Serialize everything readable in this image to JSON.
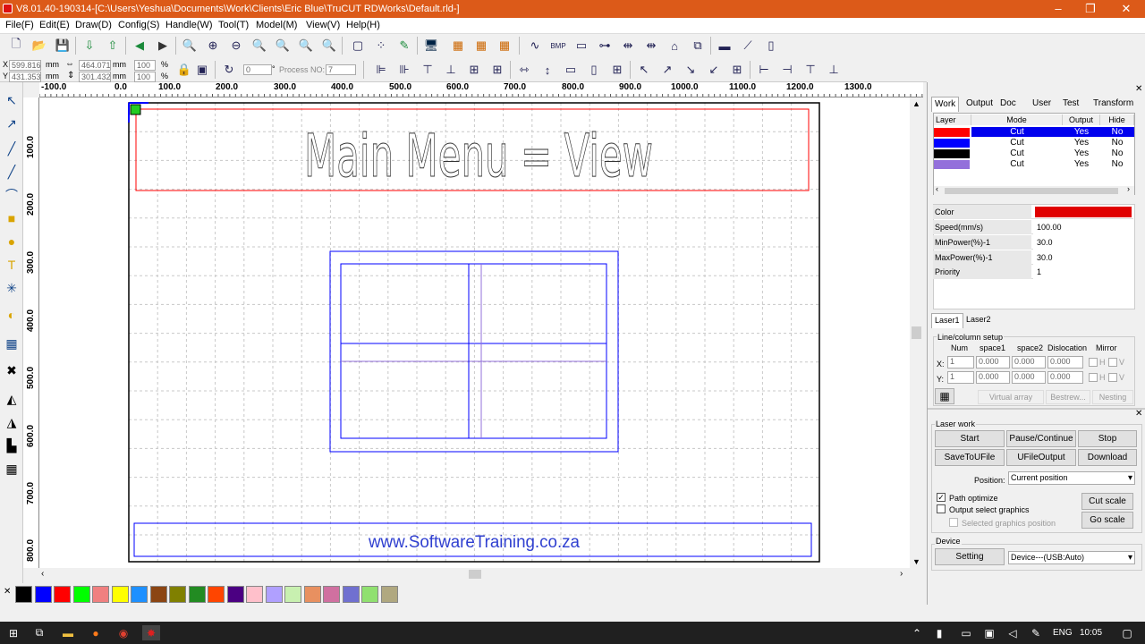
{
  "window": {
    "title": "V8.01.40-190314-[C:\\Users\\Yeshua\\Documents\\Work\\Clients\\Eric Blue\\TruCUT RDWorks\\Default.rld-]",
    "controls": [
      "–",
      "❐",
      "✕"
    ]
  },
  "menu": [
    "File(F)",
    "Edit(E)",
    "Draw(D)",
    "Config(S)",
    "Handle(W)",
    "Tool(T)",
    "Model(M)",
    "View(V)",
    "Help(H)"
  ],
  "coords": {
    "x_label": "X",
    "x_value": "599.816",
    "x_unit": "mm",
    "y_label": "Y",
    "y_value": "431.353",
    "y_unit": "mm",
    "w_value": "464.071",
    "w_unit": "mm",
    "h_value": "301.432",
    "h_unit": "mm",
    "sx_value": "100",
    "sx_unit": "%",
    "sy_value": "100",
    "sy_unit": "%",
    "rotate_value": "0",
    "rotate_unit": "°",
    "process_label": "Process NO:",
    "process_value": "7"
  },
  "ruler_h": [
    "-100.0",
    "0.0",
    "100.0",
    "200.0",
    "300.0",
    "400.0",
    "500.0",
    "600.0",
    "700.0",
    "800.0",
    "900.0",
    "1000.0",
    "1100.0",
    "1200.0",
    "1300.0"
  ],
  "ruler_v": [
    "100.0",
    "200.0",
    "300.0",
    "400.0",
    "500.0",
    "600.0",
    "700.0",
    "800.0"
  ],
  "canvas": {
    "headline": "Main Menu = View",
    "footer_url": "www.SoftwareTraining.co.za"
  },
  "palette": [
    "#000000",
    "#0000ff",
    "#ff0000",
    "#00ff00",
    "#f08080",
    "#ffff00",
    "#1e90ff",
    "#8b4513",
    "#808000",
    "#228b22",
    "#ff4500",
    "#4b0082",
    "#ffc0cb",
    "#b0a0ff",
    "#c8f0b0",
    "#e89060",
    "#d070a0",
    "#7070d0",
    "#90e070",
    "#b0a880"
  ],
  "panel": {
    "tabs": [
      "Work",
      "Output",
      "Doc",
      "User",
      "Test",
      "Transform"
    ],
    "active_tab": "Work",
    "layer_headers": [
      "Layer",
      "Mode",
      "Output",
      "Hide"
    ],
    "layers": [
      {
        "color": "#ff0000",
        "mode": "Cut",
        "output": "Yes",
        "hide": "No"
      },
      {
        "color": "#0000ff",
        "mode": "Cut",
        "output": "Yes",
        "hide": "No"
      },
      {
        "color": "#000000",
        "mode": "Cut",
        "output": "Yes",
        "hide": "No"
      },
      {
        "color": "#9370db",
        "mode": "Cut",
        "output": "Yes",
        "hide": "No"
      }
    ],
    "props": {
      "color_label": "Color",
      "color_value": "#e00000",
      "speed_label": "Speed(mm/s)",
      "speed_value": "100.00",
      "minpower_label": "MinPower(%)-1",
      "minpower_value": "30.0",
      "maxpower_label": "MaxPower(%)-1",
      "maxpower_value": "30.0",
      "priority_label": "Priority",
      "priority_value": "1"
    },
    "laser_tabs": [
      "Laser1",
      "Laser2"
    ],
    "linecol": {
      "title": "Line/column setup",
      "headers": [
        "Num",
        "space1",
        "space2",
        "Dislocation",
        "Mirror"
      ],
      "x_label": "X:",
      "y_label": "Y:",
      "x_num": "1",
      "x_s1": "0.000",
      "x_s2": "0.000",
      "x_dis": "0.000",
      "y_num": "1",
      "y_s1": "0.000",
      "y_s2": "0.000",
      "y_dis": "0.000",
      "h": "H",
      "v": "V",
      "virtual_array": "Virtual array",
      "bestrew": "Bestrew...",
      "nesting": "Nesting"
    },
    "laserwork": {
      "title": "Laser work",
      "start": "Start",
      "pause": "Pause/Continue",
      "stop": "Stop",
      "save_to_ufile": "SaveToUFile",
      "ufile_output": "UFileOutput",
      "download": "Download",
      "position_label": "Position:",
      "position_value": "Current position",
      "path_optimize": "Path optimize",
      "output_select": "Output select graphics",
      "selected_position": "Selected graphics position",
      "cut_scale": "Cut scale",
      "go_scale": "Go scale"
    },
    "device": {
      "title": "Device",
      "setting": "Setting",
      "device_value": "Device---(USB:Auto)"
    }
  },
  "taskbar": {
    "lang": "ENG",
    "time": "10:05"
  }
}
